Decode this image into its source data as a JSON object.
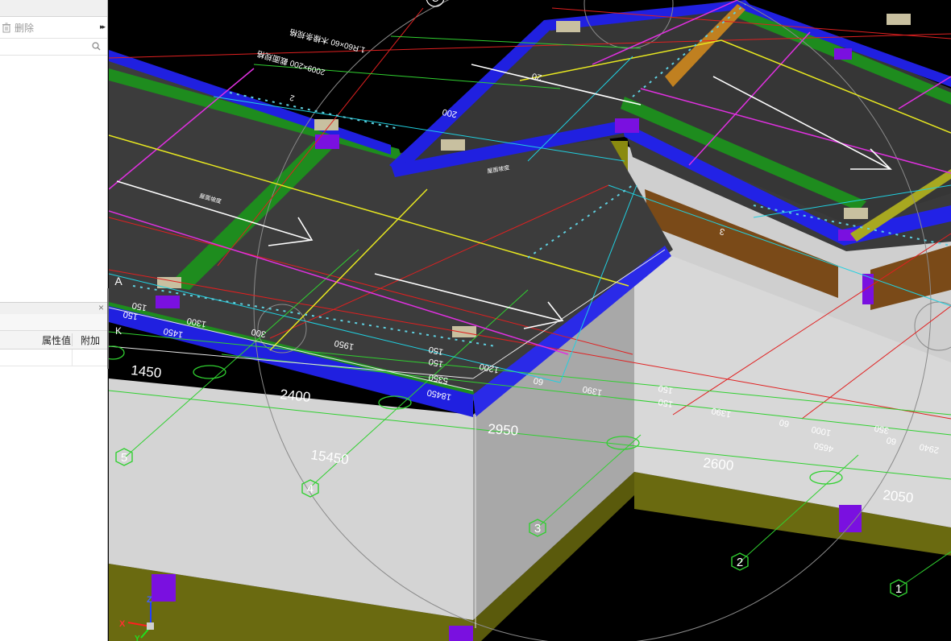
{
  "left_panel": {
    "toolbar": {
      "delete_label": "删除",
      "expand_label": "▸▸"
    },
    "search": {
      "placeholder": ""
    },
    "properties": {
      "close_label": "×",
      "col_value": "属性值",
      "col_extra": "附加"
    }
  },
  "viewport": {
    "axis_labels": {
      "A": "A",
      "C": "C",
      "K": "K"
    },
    "grid_numbers": [
      "5",
      "4",
      "3",
      "2",
      "1"
    ],
    "dims_large": [
      "1450",
      "2400",
      "15450",
      "2950",
      "2600",
      "2050"
    ],
    "dims_small": [
      "150",
      "150",
      "1450",
      "1300",
      "300",
      "1950",
      "150",
      "150",
      "5350",
      "18450",
      "1200",
      "60",
      "1390",
      "1390",
      "150",
      "150",
      "60",
      "1000",
      "4650",
      "350",
      "60",
      "2940",
      "200",
      "20",
      "3"
    ],
    "annotations": [
      "2009×200 截面规格",
      "1.R60×60 木椽条规格",
      "2",
      "屋面坡度",
      "屋面坡度"
    ],
    "compass": {
      "x": "X",
      "y": "Y",
      "z": "Z"
    },
    "colors": {
      "background": "#000000",
      "wall": "#d4d4d4",
      "roof": "#3c3c3c",
      "beam_blue": "#2020e0",
      "beam_green": "#1e8c1e",
      "base_olive": "#6a6a10",
      "column_purple": "#7a10e0",
      "timber_orange": "#f0902a"
    }
  }
}
